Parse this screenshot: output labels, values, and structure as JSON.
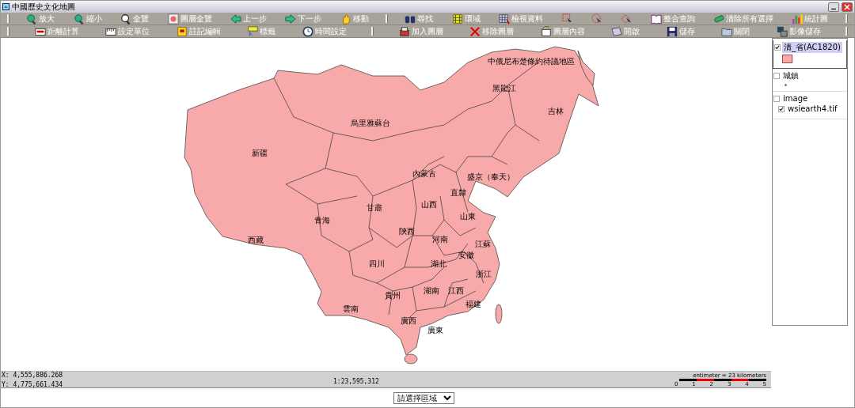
{
  "window": {
    "title": "中國歷史文化地圖"
  },
  "toolbar_rows": [
    {
      "items": [
        {
          "kind": "separator"
        },
        {
          "kind": "button",
          "label": "放大"
        },
        {
          "kind": "button",
          "label": "縮小"
        },
        {
          "kind": "button",
          "label": "全覽"
        },
        {
          "kind": "button",
          "label": "圖層全覽"
        },
        {
          "kind": "button",
          "label": "上一步"
        },
        {
          "kind": "button",
          "label": "下一步"
        },
        {
          "kind": "button",
          "label": "移動"
        },
        {
          "kind": "separator"
        },
        {
          "kind": "button",
          "label": "尋找"
        },
        {
          "kind": "button",
          "label": "環域"
        },
        {
          "kind": "button",
          "label": "檢視資料"
        },
        {
          "kind": "icon"
        },
        {
          "kind": "icon"
        },
        {
          "kind": "icon"
        },
        {
          "kind": "button",
          "label": "整合查詢"
        },
        {
          "kind": "button",
          "label": "清除所有選擇"
        },
        {
          "kind": "button",
          "label": "統計圖"
        },
        {
          "kind": "separator"
        }
      ]
    },
    {
      "items": [
        {
          "kind": "separator"
        },
        {
          "kind": "button",
          "label": "距離計算"
        },
        {
          "kind": "button",
          "label": "設定單位"
        },
        {
          "kind": "button",
          "label": "註記編輯"
        },
        {
          "kind": "button",
          "label": "標籤"
        },
        {
          "kind": "button",
          "label": "時間設定"
        },
        {
          "kind": "separator"
        },
        {
          "kind": "button",
          "label": "加入圖層"
        },
        {
          "kind": "button",
          "label": "移除圖層"
        },
        {
          "kind": "button",
          "label": "圖層內容"
        },
        {
          "kind": "button",
          "label": "開啟"
        },
        {
          "kind": "button",
          "label": "儲存"
        },
        {
          "kind": "button",
          "label": "關閉"
        },
        {
          "kind": "button",
          "label": "影像儲存"
        },
        {
          "kind": "separator"
        }
      ]
    }
  ],
  "map": {
    "regions": [
      {
        "name": "中俄尼布楚條約待議地區"
      },
      {
        "name": "黑龍江"
      },
      {
        "name": "吉林"
      },
      {
        "name": "烏里雅蘇台"
      },
      {
        "name": "新疆"
      },
      {
        "name": "內蒙古"
      },
      {
        "name": "盛京（奉天）"
      },
      {
        "name": "直隸"
      },
      {
        "name": "山西"
      },
      {
        "name": "甘肅"
      },
      {
        "name": "山東"
      },
      {
        "name": "青海"
      },
      {
        "name": "陝西"
      },
      {
        "name": "河南"
      },
      {
        "name": "西藏"
      },
      {
        "name": "江蘇"
      },
      {
        "name": "安徽"
      },
      {
        "name": "四川"
      },
      {
        "name": "湖北"
      },
      {
        "name": "浙江"
      },
      {
        "name": "湖南"
      },
      {
        "name": "江西"
      },
      {
        "name": "貴州"
      },
      {
        "name": "福建"
      },
      {
        "name": "雲南"
      },
      {
        "name": "廣西"
      },
      {
        "name": "廣東"
      }
    ]
  },
  "layers": [
    {
      "name": "清_省(AC1820)",
      "checked": true,
      "selected": true,
      "color": "#f8aaaa",
      "kind": "polygon"
    },
    {
      "name": "城鎮",
      "checked": false,
      "selected": false,
      "kind": "point"
    },
    {
      "name": "image",
      "checked": false,
      "selected": false,
      "children": [
        {
          "name": "wsiearth4.tif",
          "checked": true,
          "selected": false
        }
      ]
    }
  ],
  "status_bar": {
    "x": "X: 4,555,886.268",
    "y": "Y: 4,775,661.434",
    "scale": "1:23,595,312",
    "scale_bar": {
      "caption": "entimeter = 23 kilometers",
      "ticks": [
        "0",
        "1",
        "2",
        "3",
        "4",
        "5"
      ]
    }
  },
  "region_select": {
    "value": "請選擇區域"
  }
}
